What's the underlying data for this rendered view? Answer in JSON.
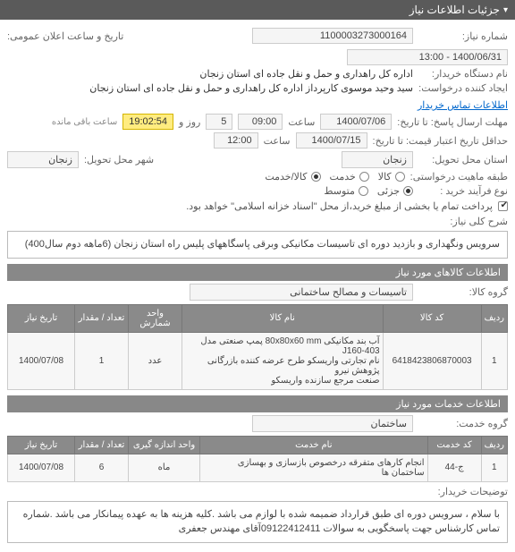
{
  "header": {
    "title": "جزئیات اطلاعات نیاز"
  },
  "fields": {
    "need_number_label": "شماره نیاز:",
    "need_number": "1100003273000164",
    "announce_label": "تاریخ و ساعت اعلان عمومی:",
    "announce_value": "1400/06/31 - 13:00",
    "buyer_org_label": "نام دستگاه خریدار:",
    "buyer_org": "اداره کل راهداری و حمل و نقل جاده ای استان زنجان",
    "requester_label": "ایجاد کننده درخواست:",
    "requester": "سید وحید موسوی کارپرداز اداره کل راهداری و حمل و نقل جاده ای استان زنجان",
    "buyer_contact_link": "اطلاعات تماس خریدار",
    "deadline_label": "مهلت ارسال پاسخ: تا تاریخ:",
    "deadline_date": "1400/07/06",
    "deadline_time_label": "ساعت",
    "deadline_time": "09:00",
    "remaining_days": "5",
    "remaining_days_label": "روز و",
    "remaining_time": "19:02:54",
    "remaining_suffix": "ساعت باقی مانده",
    "validity_label": "حداقل تاریخ اعتبار قیمت: تا تاریخ:",
    "validity_date": "1400/07/15",
    "validity_time_label": "ساعت",
    "validity_time": "12:00",
    "delivery_province_label": "استان محل تحویل:",
    "delivery_province": "زنجان",
    "delivery_city_label": "شهر محل تحویل:",
    "delivery_city": "زنجان",
    "request_nature_label": "طبقه ماهیت درخواستی:",
    "nature_options": {
      "goods": "کالا",
      "service": "خدمت",
      "goods_service": "کالا/خدمت"
    },
    "nature_selected": "goods_service",
    "process_label": "نوع فرآیند خرید :",
    "process_options": {
      "partial": "جزئی",
      "medium": "متوسط"
    },
    "process_selected": "partial",
    "payment_note": "پرداخت تمام یا بخشی از مبلغ خرید،از محل \"اسناد خزانه اسلامی\" خواهد بود.",
    "general_summary_label": "شرح کلی نیاز:",
    "general_summary": "سرویس ونگهداری و بازدید دوره ای تاسیسات مکانیکی وبرقی پاسگاههای پلیس راه استان زنجان (6ماهه دوم سال400)"
  },
  "goods_section": {
    "title": "اطلاعات کالاهای مورد نیاز",
    "group_label": "گروه کالا:",
    "group_value": "تاسیسات و مصالح ساختمانی",
    "columns": {
      "idx": "ردیف",
      "code": "کد کالا",
      "name": "نام کالا",
      "unit": "واحد شمارش",
      "qty": "تعداد / مقدار",
      "date": "تاریخ نیاز"
    },
    "rows": [
      {
        "idx": "1",
        "code": "6418423806870003",
        "name": "آب بند مکانیکی 80x80x60 mm پمپ صنعتی مدل J160-403\nنام تجارتی واریسکو طرح عرضه کننده بازرگانی پژوهش نیرو\nصنعت مرجع سازنده واریسکو",
        "unit": "عدد",
        "qty": "1",
        "date": "1400/07/08"
      }
    ]
  },
  "services_section": {
    "title": "اطلاعات خدمات مورد نیاز",
    "group_label": "گروه خدمت:",
    "group_value": "ساختمان",
    "columns": {
      "idx": "ردیف",
      "code": "کد خدمت",
      "name": "نام خدمت",
      "unit": "واحد اندازه گیری",
      "qty": "تعداد / مقدار",
      "date": "تاریخ نیاز"
    },
    "rows": [
      {
        "idx": "1",
        "code": "ج-44",
        "name": "انجام کارهای متفرقه درخصوص بازسازی و بهسازی ساختمان ها",
        "unit": "ماه",
        "qty": "6",
        "date": "1400/07/08"
      }
    ]
  },
  "buyer_notes": {
    "label": "توضیحات خریدار:",
    "text": "با سلام ، سرویس دوره ای طبق قرارداد ضمیمه شده با لوازم می باشد .کلیه هزینه ها به عهده پیمانکار می باشد .شماره تماس کارشناس جهت پاسخگویی به سوالات 09122412411آقای مهندس جعفری"
  }
}
